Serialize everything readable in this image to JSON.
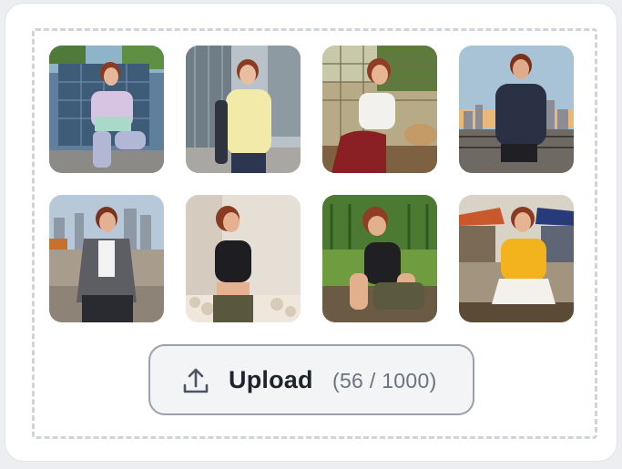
{
  "upload": {
    "label": "Upload",
    "count": "(56 / 1000)",
    "icon": "upload-icon"
  },
  "gallery": {
    "items": [
      {
        "scene": "glass office building, pastel tie-dye top"
      },
      {
        "scene": "city street, yellow sweater"
      },
      {
        "scene": "outdoor table with basket, white top red skirt"
      },
      {
        "scene": "rooftop city skyline at sunset, navy hoodie"
      },
      {
        "scene": "park bench with skyline, gray blazer"
      },
      {
        "scene": "studio, black crop top"
      },
      {
        "scene": "vineyard, black tank top"
      },
      {
        "scene": "street market, yellow tee white skirt"
      }
    ]
  },
  "colors": {
    "card_bg": "#ffffff",
    "page_bg": "#eceef1",
    "dash": "#cfd3da",
    "button_border": "#9aa1ab",
    "button_bg": "#f2f4f6",
    "text_dark": "#1f242c",
    "text_muted": "#6b7280"
  }
}
